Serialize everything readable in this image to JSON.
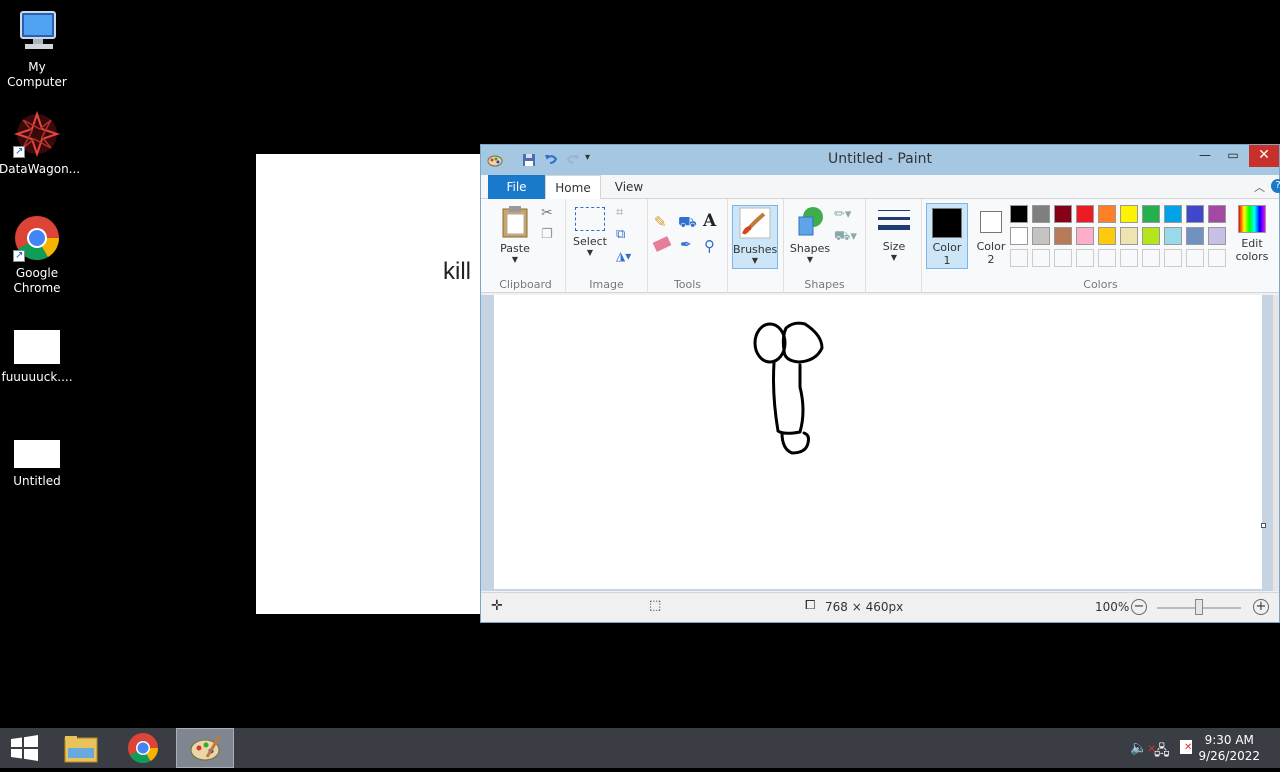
{
  "desktop": {
    "icons": [
      {
        "label": "My\nComputer"
      },
      {
        "label": "DataWagon..."
      },
      {
        "label": "Google\nChrome"
      },
      {
        "label": "fuuuuuck...."
      },
      {
        "label": "Untitled"
      }
    ],
    "background_window_text": "kill"
  },
  "paint": {
    "title": "Untitled - Paint",
    "tabs": {
      "file": "File",
      "home": "Home",
      "view": "View"
    },
    "ribbon": {
      "paste": "Paste",
      "clipboard_group": "Clipboard",
      "select": "Select",
      "image_group": "Image",
      "tools_group": "Tools",
      "brushes": "Brushes",
      "shapes": "Shapes",
      "shapes_group": "Shapes",
      "size": "Size",
      "color1": "Color\n1",
      "color2": "Color\n2",
      "edit_colors": "Edit\ncolors",
      "colors_group": "Colors"
    },
    "palette_row1": [
      "#000000",
      "#7f7f7f",
      "#880015",
      "#ed1c24",
      "#ff7f27",
      "#fff200",
      "#22b14c",
      "#00a2e8",
      "#3f48cc",
      "#a349a4"
    ],
    "palette_row2": [
      "#ffffff",
      "#c3c3c3",
      "#b97a57",
      "#ffaec9",
      "#ffc90e",
      "#efe4b0",
      "#b5e61d",
      "#99d9ea",
      "#7092be",
      "#c8bfe7"
    ],
    "color1_value": "#000000",
    "color2_value": "#ffffff",
    "status": {
      "dimensions": "768 × 460px",
      "zoom": "100%"
    }
  },
  "taskbar": {
    "time": "9:30 AM",
    "date": "9/26/2022"
  }
}
